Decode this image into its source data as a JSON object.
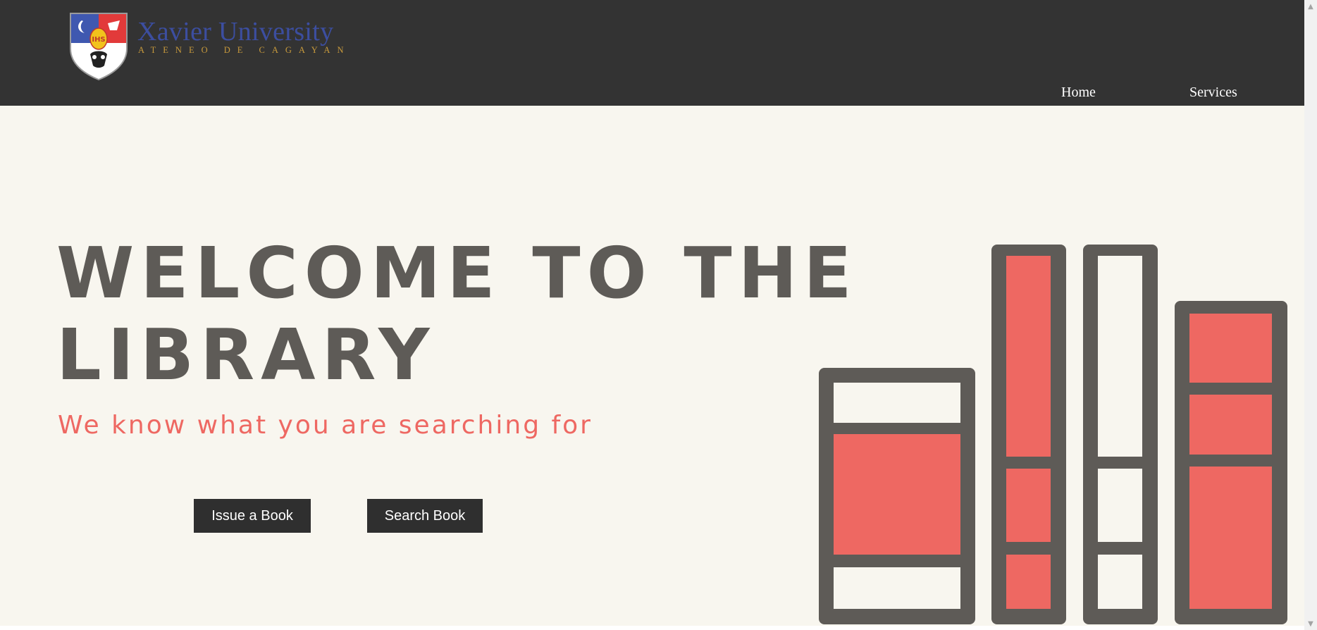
{
  "header": {
    "logo": {
      "title": "Xavier University",
      "subtitle": "ATENEO DE CAGAYAN",
      "crest_icon": "university-crest-icon"
    },
    "nav": {
      "home_label": "Home",
      "services_label": "Services"
    }
  },
  "hero": {
    "title": "WELCOME TO THE LIBRARY",
    "tagline": "We know what you are searching for",
    "issue_button_label": "Issue a Book",
    "search_button_label": "Search Book",
    "illustration_icon": "books-illustration-icon"
  },
  "colors": {
    "header_bg": "#333333",
    "page_bg": "#f8f6ef",
    "title_text": "#5e5b57",
    "accent_red": "#ee6862",
    "button_bg": "#2f2f2f",
    "logo_blue": "#3c4ea0",
    "logo_gold": "#c89a3c"
  },
  "scrollbar": {
    "up_icon": "scroll-up-arrow-icon",
    "down_icon": "scroll-down-arrow-icon"
  }
}
